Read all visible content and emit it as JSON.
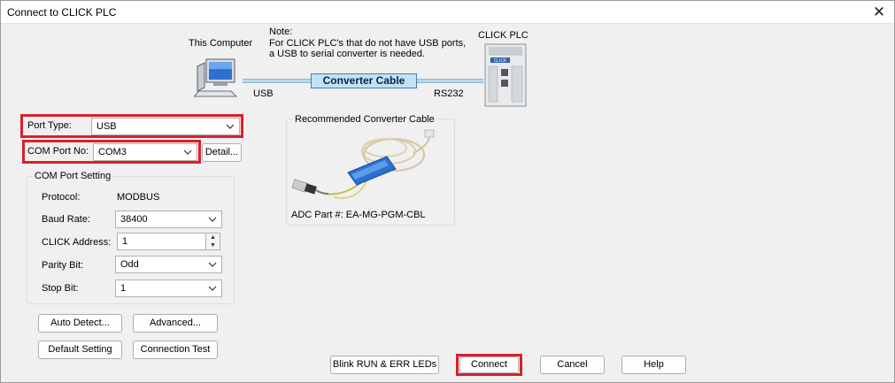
{
  "window": {
    "title": "Connect to CLICK PLC"
  },
  "diagram": {
    "computer_label": "This Computer",
    "plc_label": "CLICK PLC",
    "note_lines": [
      "Note:",
      "For CLICK PLC's that do not have USB ports,",
      "a USB to serial converter is needed."
    ],
    "cable_label": "Converter Cable",
    "usb_label": "USB",
    "rs232_label": "RS232",
    "plc_brand": "CLICK"
  },
  "port_type": {
    "label": "Port Type:",
    "value": "USB"
  },
  "com_port": {
    "label": "COM Port No:",
    "value": "COM3",
    "detail_button": "Detail..."
  },
  "com_port_setting": {
    "title": "COM Port Setting",
    "protocol_label": "Protocol:",
    "protocol_value": "MODBUS",
    "baud_label": "Baud Rate:",
    "baud_value": "38400",
    "address_label": "CLICK Address:",
    "address_value": "1",
    "parity_label": "Parity Bit:",
    "parity_value": "Odd",
    "stop_label": "Stop Bit:",
    "stop_value": "1"
  },
  "recommended": {
    "title": "Recommended Converter Cable",
    "part_number": "ADC Part #: EA-MG-PGM-CBL"
  },
  "buttons": {
    "auto_detect": "Auto Detect...",
    "advanced": "Advanced...",
    "default_setting": "Default Setting",
    "connection_test": "Connection Test",
    "blink_leds": "Blink RUN & ERR LEDs",
    "connect": "Connect",
    "cancel": "Cancel",
    "help": "Help"
  },
  "colors": {
    "highlight": "#d9202a",
    "cable": "#bfe3f5",
    "window_bg": "#f0f0f0"
  },
  "icons": {
    "close": "close-icon",
    "dropdown": "chevron-down-icon"
  }
}
